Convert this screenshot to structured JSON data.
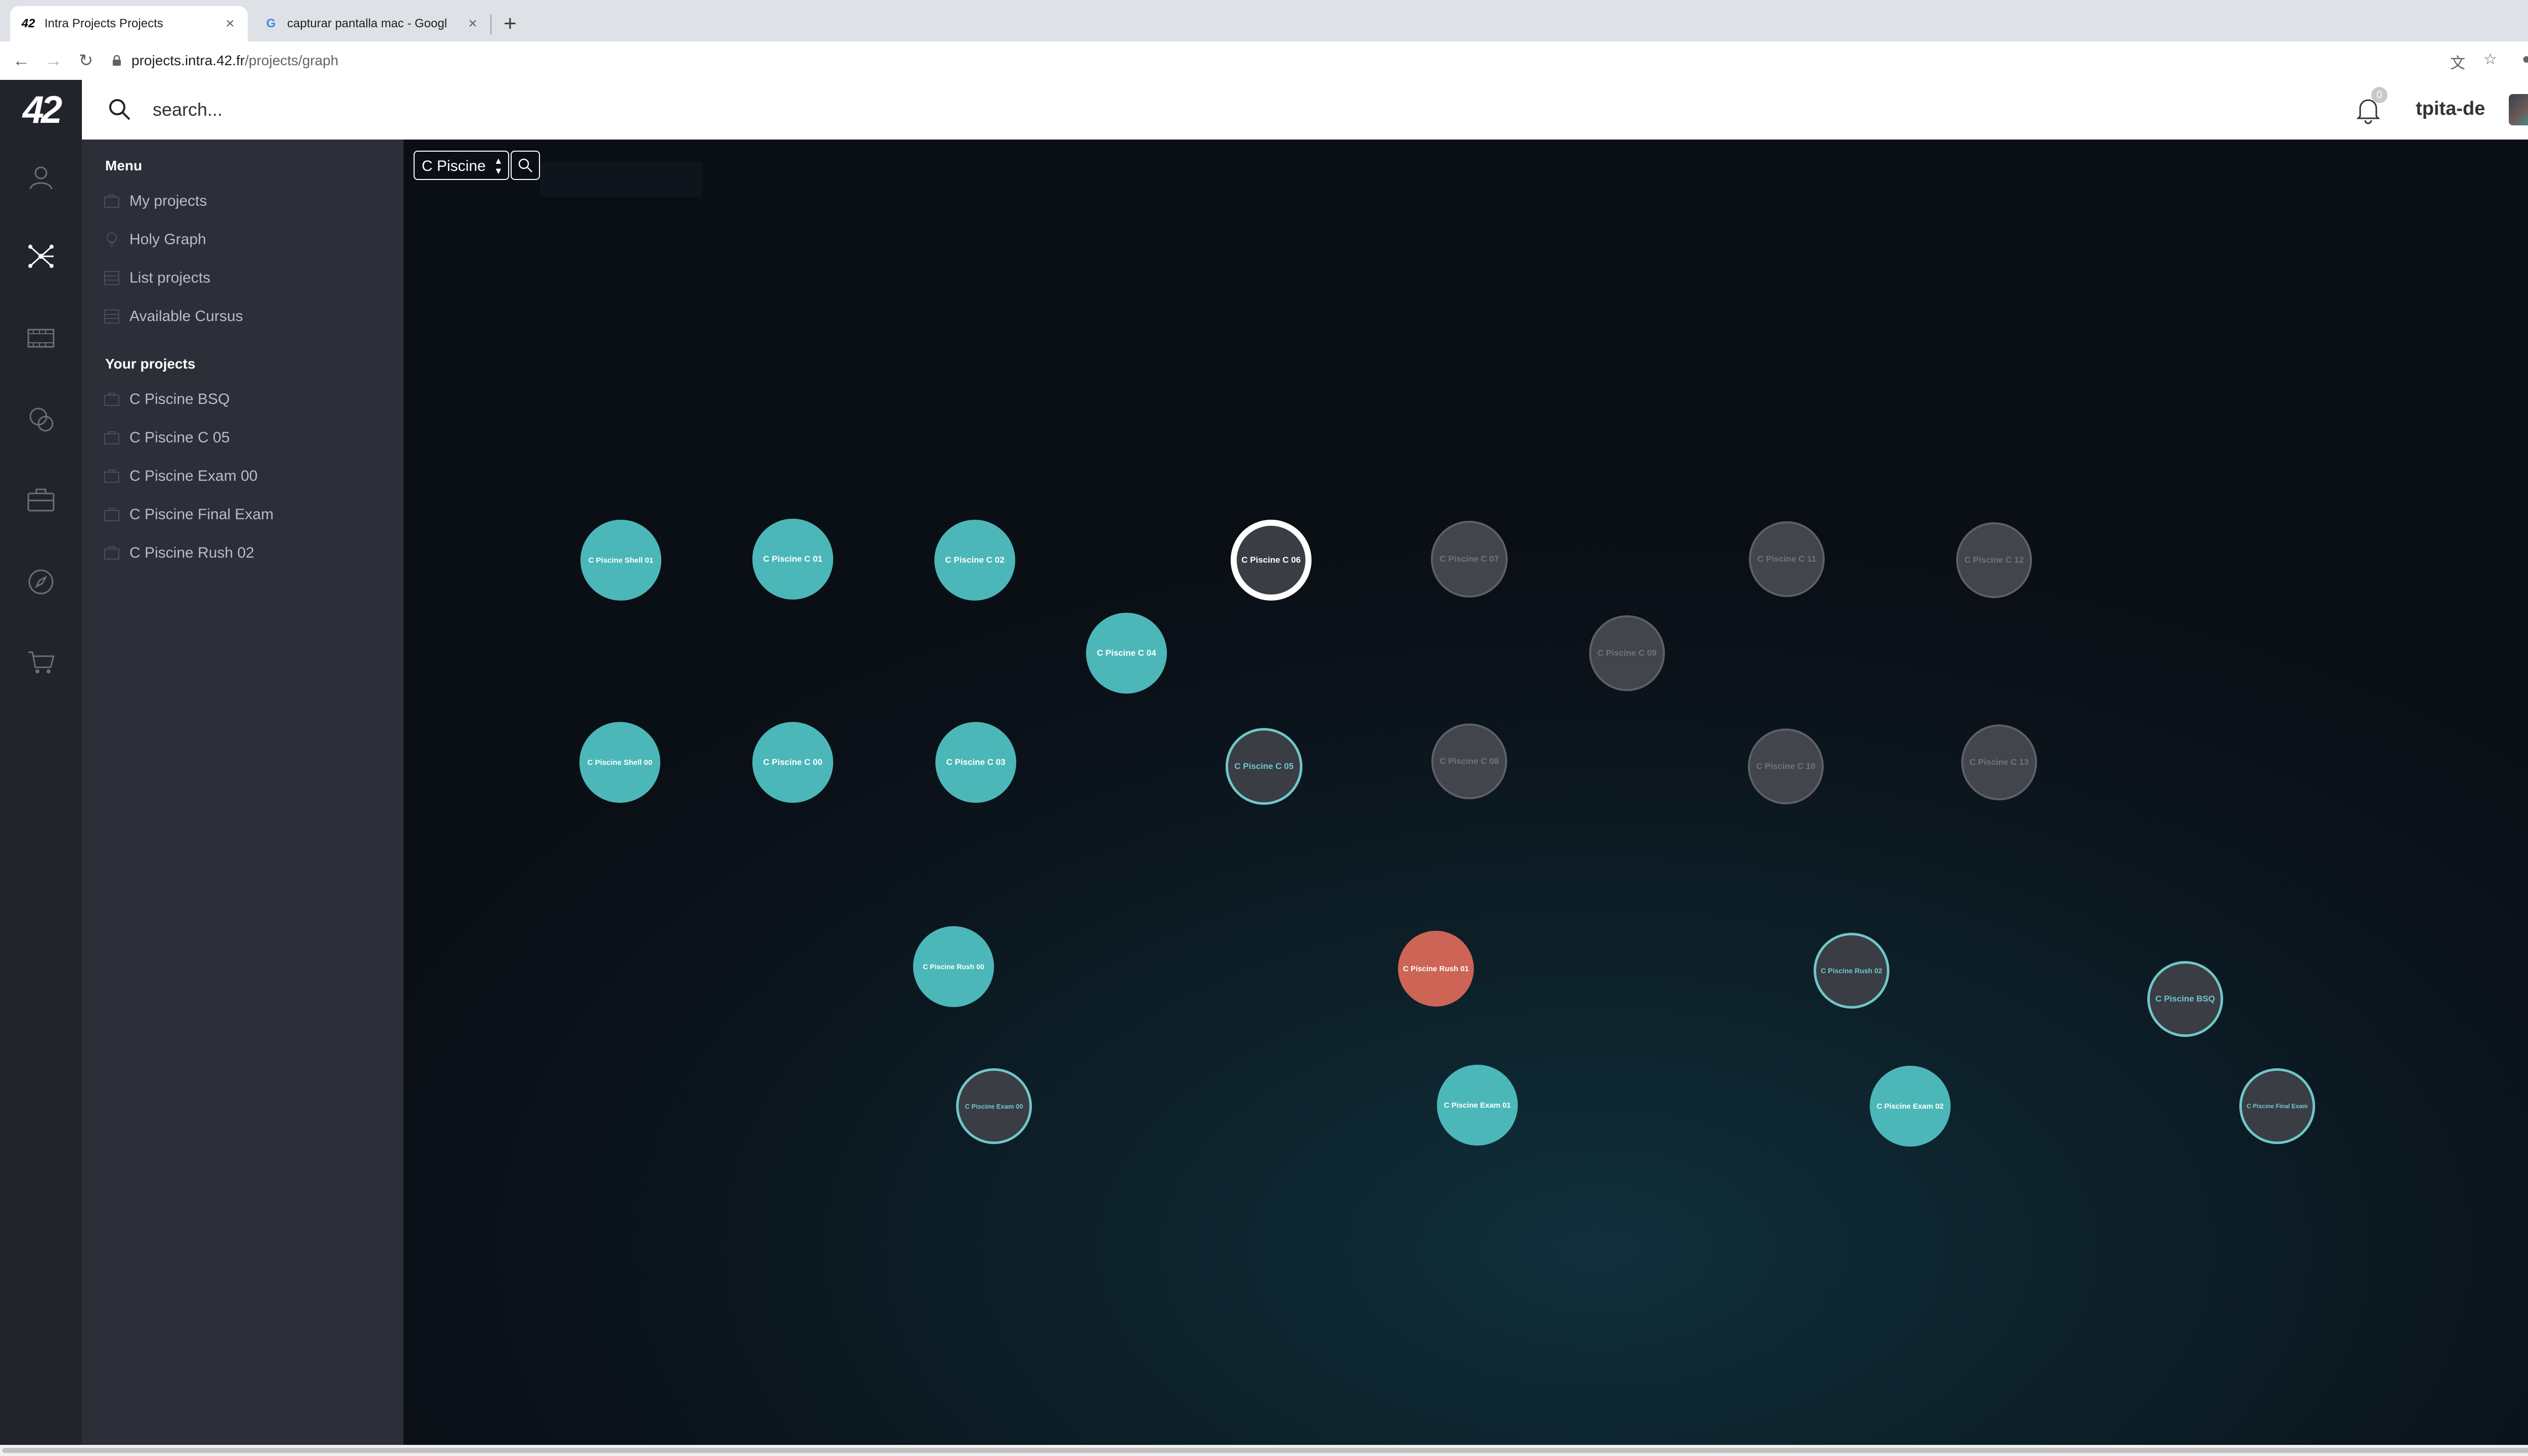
{
  "browser": {
    "tabs": [
      {
        "title": "Intra Projects Projects",
        "favicon": "42-logo-icon",
        "active": true
      },
      {
        "title": "capturar pantalla mac - Googl",
        "favicon": "google-icon",
        "active": false
      }
    ],
    "url_host": "projects.intra.42.fr",
    "url_path": "/projects/graph"
  },
  "app": {
    "logo": "42",
    "search_placeholder": "search...",
    "notifications_count": "0",
    "username": "tpita-de",
    "rail_icons": [
      "profile-icon",
      "graph-icon",
      "video-icon",
      "chat-icon",
      "briefcase-icon",
      "compass-icon",
      "cart-icon"
    ]
  },
  "menu": {
    "menu_heading": "Menu",
    "menu_items": [
      {
        "label": "My projects",
        "icon": "folder-icon"
      },
      {
        "label": "Holy Graph",
        "icon": "bulb-icon"
      },
      {
        "label": "List projects",
        "icon": "list-icon"
      },
      {
        "label": "Available Cursus",
        "icon": "list-icon"
      }
    ],
    "projects_heading": "Your projects",
    "projects": [
      {
        "label": "C Piscine BSQ"
      },
      {
        "label": "C Piscine C 05"
      },
      {
        "label": "C Piscine Exam 00"
      },
      {
        "label": "C Piscine Final Exam"
      },
      {
        "label": "C Piscine Rush 02"
      }
    ]
  },
  "graph": {
    "filter_value": "C Piscine",
    "status_colors": {
      "done": "#4cb7b9",
      "available": "#6fc7c9",
      "locked": "#5d6066",
      "failed": "#cd6557",
      "current": "#ffffff"
    },
    "nodes": [
      {
        "label": "C Piscine Shell 01",
        "status": "done"
      },
      {
        "label": "C Piscine C 01",
        "status": "done"
      },
      {
        "label": "C Piscine C 02",
        "status": "done"
      },
      {
        "label": "C Piscine C 06",
        "status": "current"
      },
      {
        "label": "C Piscine C 07",
        "status": "locked"
      },
      {
        "label": "C Piscine C 11",
        "status": "locked"
      },
      {
        "label": "C Piscine C 12",
        "status": "locked"
      },
      {
        "label": "C Piscine C 04",
        "status": "done"
      },
      {
        "label": "C Piscine C 09",
        "status": "locked"
      },
      {
        "label": "C Piscine Shell 00",
        "status": "done"
      },
      {
        "label": "C Piscine C 00",
        "status": "done"
      },
      {
        "label": "C Piscine C 03",
        "status": "done"
      },
      {
        "label": "C Piscine C 05",
        "status": "available"
      },
      {
        "label": "C Piscine C 08",
        "status": "locked"
      },
      {
        "label": "C Piscine C 10",
        "status": "locked"
      },
      {
        "label": "C Piscine C 13",
        "status": "locked"
      },
      {
        "label": "C Piscine Rush 00",
        "status": "done"
      },
      {
        "label": "C Piscine Rush 01",
        "status": "failed"
      },
      {
        "label": "C Piscine Rush 02",
        "status": "available"
      },
      {
        "label": "C Piscine BSQ",
        "status": "available"
      },
      {
        "label": "C Piscine Exam 00",
        "status": "available"
      },
      {
        "label": "C Piscine Exam 01",
        "status": "done"
      },
      {
        "label": "C Piscine Exam 02",
        "status": "done"
      },
      {
        "label": "C Piscine Final Exam",
        "status": "available"
      }
    ]
  }
}
